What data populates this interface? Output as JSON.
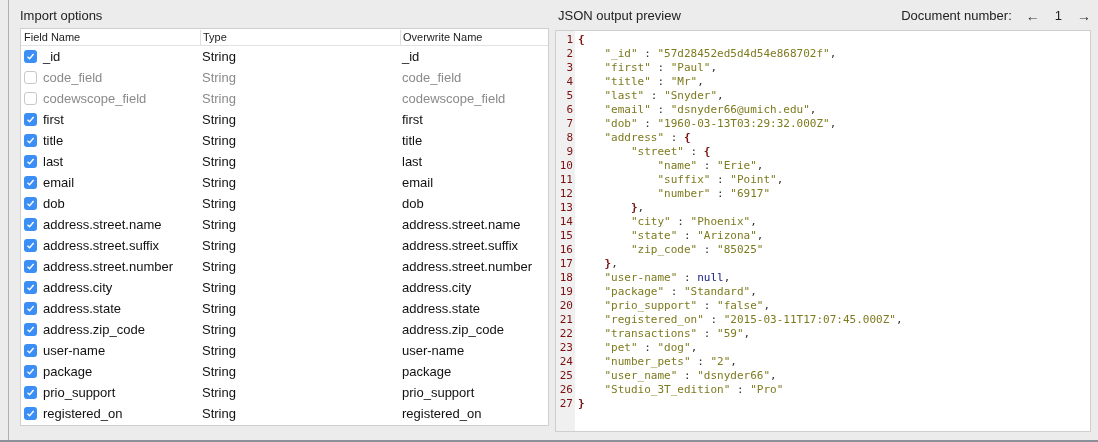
{
  "import_options": {
    "title": "Import options",
    "columns": [
      "Field Name",
      "Type",
      "Overwrite Name"
    ],
    "rows": [
      {
        "field": "_id",
        "type": "String",
        "overwrite": "_id",
        "checked": true
      },
      {
        "field": "code_field",
        "type": "String",
        "overwrite": "code_field",
        "checked": false
      },
      {
        "field": "codewscope_field",
        "type": "String",
        "overwrite": "codewscope_field",
        "checked": false
      },
      {
        "field": "first",
        "type": "String",
        "overwrite": "first",
        "checked": true
      },
      {
        "field": "title",
        "type": "String",
        "overwrite": "title",
        "checked": true
      },
      {
        "field": "last",
        "type": "String",
        "overwrite": "last",
        "checked": true
      },
      {
        "field": "email",
        "type": "String",
        "overwrite": "email",
        "checked": true
      },
      {
        "field": "dob",
        "type": "String",
        "overwrite": "dob",
        "checked": true
      },
      {
        "field": "address.street.name",
        "type": "String",
        "overwrite": "address.street.name",
        "checked": true
      },
      {
        "field": "address.street.suffix",
        "type": "String",
        "overwrite": "address.street.suffix",
        "checked": true
      },
      {
        "field": "address.street.number",
        "type": "String",
        "overwrite": "address.street.number",
        "checked": true
      },
      {
        "field": "address.city",
        "type": "String",
        "overwrite": "address.city",
        "checked": true
      },
      {
        "field": "address.state",
        "type": "String",
        "overwrite": "address.state",
        "checked": true
      },
      {
        "field": "address.zip_code",
        "type": "String",
        "overwrite": "address.zip_code",
        "checked": true
      },
      {
        "field": "user-name",
        "type": "String",
        "overwrite": "user-name",
        "checked": true
      },
      {
        "field": "package",
        "type": "String",
        "overwrite": "package",
        "checked": true
      },
      {
        "field": "prio_support",
        "type": "String",
        "overwrite": "prio_support",
        "checked": true
      },
      {
        "field": "registered_on",
        "type": "String",
        "overwrite": "registered_on",
        "checked": true
      }
    ]
  },
  "preview": {
    "title": "JSON output preview",
    "document_label": "Document number:",
    "prev": "←",
    "document_number": "1",
    "next": "→",
    "lines": [
      {
        "number": "1",
        "text": "{"
      },
      {
        "number": "2",
        "text": "    \"_id\" : \"57d28452ed5d4d54e868702f\","
      },
      {
        "number": "3",
        "text": "    \"first\" : \"Paul\","
      },
      {
        "number": "4",
        "text": "    \"title\" : \"Mr\","
      },
      {
        "number": "5",
        "text": "    \"last\" : \"Snyder\","
      },
      {
        "number": "6",
        "text": "    \"email\" : \"dsnyder66@umich.edu\","
      },
      {
        "number": "7",
        "text": "    \"dob\" : \"1960-03-13T03:29:32.000Z\","
      },
      {
        "number": "8",
        "text": "    \"address\" : {"
      },
      {
        "number": "9",
        "text": "        \"street\" : {"
      },
      {
        "number": "10",
        "text": "            \"name\" : \"Erie\","
      },
      {
        "number": "11",
        "text": "            \"suffix\" : \"Point\","
      },
      {
        "number": "12",
        "text": "            \"number\" : \"6917\""
      },
      {
        "number": "13",
        "text": "        },"
      },
      {
        "number": "14",
        "text": "        \"city\" : \"Phoenix\","
      },
      {
        "number": "15",
        "text": "        \"state\" : \"Arizona\","
      },
      {
        "number": "16",
        "text": "        \"zip_code\" : \"85025\""
      },
      {
        "number": "17",
        "text": "    },"
      },
      {
        "number": "18",
        "text": "    \"user-name\" : null,"
      },
      {
        "number": "19",
        "text": "    \"package\" : \"Standard\","
      },
      {
        "number": "20",
        "text": "    \"prio_support\" : \"false\","
      },
      {
        "number": "21",
        "text": "    \"registered_on\" : \"2015-03-11T17:07:45.000Z\","
      },
      {
        "number": "22",
        "text": "    \"transactions\" : \"59\","
      },
      {
        "number": "23",
        "text": "    \"pet\" : \"dog\","
      },
      {
        "number": "24",
        "text": "    \"number_pets\" : \"2\","
      },
      {
        "number": "25",
        "text": "    \"user_name\" : \"dsnyder66\","
      },
      {
        "number": "26",
        "text": "    \"Studio_3T_edition\" : \"Pro\""
      },
      {
        "number": "27",
        "text": "}"
      }
    ]
  }
}
